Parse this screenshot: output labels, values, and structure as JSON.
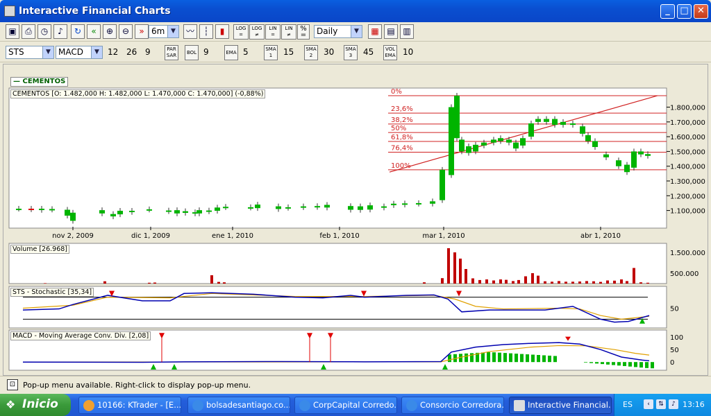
{
  "window": {
    "title": "Interactive Financial Charts"
  },
  "toolbar1": {
    "period_value": "6m",
    "interval_value": "Daily",
    "icons": [
      "save-icon",
      "print-icon",
      "clock-icon",
      "sound-icon",
      "refresh-icon",
      "rewind-icon",
      "zoom-in-icon",
      "zoom-out-icon",
      "fast-forward-icon",
      "line-chart-icon",
      "bar-chart-icon",
      "candlestick-chart-icon",
      "log-scale-icon",
      "log-diff-icon",
      "linear-scale-icon",
      "linear-diff-icon",
      "percent-icon",
      "palette-icon",
      "layout-icon",
      "table-icon"
    ],
    "scale_buttons": [
      "LOG",
      "LOG",
      "LIN",
      "LIN",
      "%"
    ]
  },
  "toolbar2": {
    "symbol_value": "STS",
    "indicator_value": "MACD",
    "macd_params": [
      "12",
      "26",
      "9"
    ],
    "parsar_label": "PAR SAR",
    "bol_label": "BOL",
    "bol_value": "9",
    "ema_label": "EMA",
    "ema_value": "5",
    "sma1_label": "SMA 1",
    "sma1_value": "15",
    "sma2_label": "SMA 2",
    "sma2_value": "30",
    "sma3_label": "SMA 3",
    "sma3_value": "45",
    "volema_label": "VOL EMA",
    "volema_value": "10"
  },
  "chart": {
    "legend_label": "CEMENTOS",
    "price_header": "CEMENTOS [O: 1.482,000  H: 1.482,000  L: 1.470,000  C: 1.470,000] (-0,88%)",
    "volume_header": "Volume [26.968]",
    "stoch_header": "STS - Stochastic [35,34]",
    "macd_header": "MACD - Moving Average Conv. Div. [2,08]"
  },
  "chart_data": {
    "type": "candlestick",
    "x_labels": [
      "nov 2, 2009",
      "dic 1, 2009",
      "ene 1, 2010",
      "feb 1, 2010",
      "mar 1, 2010",
      "abr 1, 2010"
    ],
    "price_axis": {
      "ticks": [
        "1.800,000",
        "1.700,000",
        "1.600,000",
        "1.500,000",
        "1.400,000",
        "1.300,000",
        "1.200,000",
        "1.100,000"
      ],
      "range": [
        990,
        1920
      ]
    },
    "fib_levels": [
      {
        "label": "0%",
        "price": 1878
      },
      {
        "label": "23,6%",
        "price": 1760
      },
      {
        "label": "38,2%",
        "price": 1686
      },
      {
        "label": "50%",
        "price": 1628
      },
      {
        "label": "61,8%",
        "price": 1568
      },
      {
        "label": "76,4%",
        "price": 1495
      },
      {
        "label": "100%",
        "price": 1376
      }
    ],
    "volume_axis": {
      "ticks": [
        "1.500.000",
        "500.000"
      ],
      "range": [
        0,
        1800000
      ]
    },
    "stoch_axis": {
      "ticks": [
        "50"
      ],
      "range": [
        0,
        100
      ]
    },
    "macd_axis": {
      "ticks": [
        "100",
        "50",
        "0"
      ],
      "range": [
        -30,
        120
      ]
    },
    "colors": {
      "up": "#00b400",
      "down": "#e00000",
      "fib": "#d02020",
      "stoch_k": "#0000b0",
      "stoch_d": "#e0a000",
      "macd": "#0000b0",
      "signal": "#e0a000"
    }
  },
  "status": {
    "text": "Pop-up menu available. Right-click to display pop-up menu."
  },
  "taskbar": {
    "start_label": "Inicio",
    "tasks": [
      "10166: KTrader - [E...",
      "bolsadesantiago.co...",
      "CorpCapital Corredo...",
      "Consorcio Corredora...",
      "Interactive Financial..."
    ],
    "language": "ES",
    "clock": "13:16"
  }
}
